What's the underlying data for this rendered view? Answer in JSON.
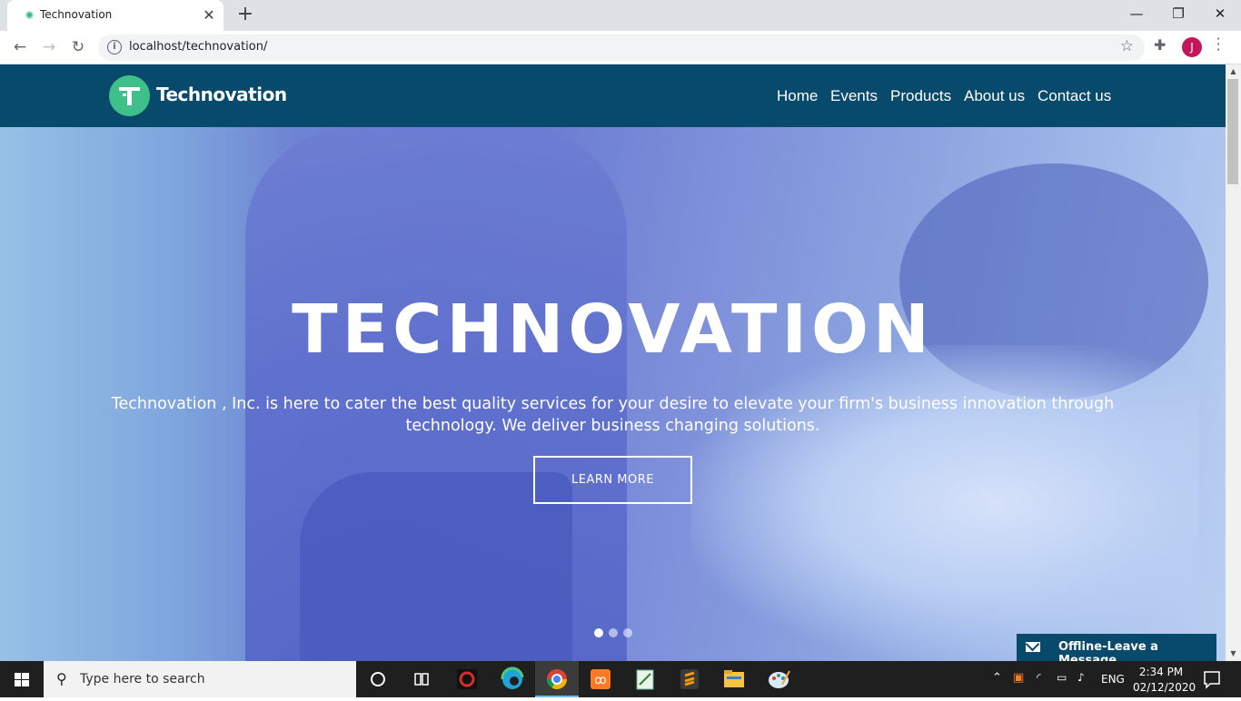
{
  "browser": {
    "tab_title": "Technovation",
    "url": "localhost/technovation/",
    "profile_initial": "J"
  },
  "site": {
    "brand": "Technovation",
    "nav": [
      "Home",
      "Events",
      "Products",
      "About us",
      "Contact us"
    ],
    "hero": {
      "title": "TECHNOVATION",
      "subtitle": "Technovation , Inc. is here to cater the best quality services for your desire to elevate your firm's business innovation through technology. We deliver business changing solutions.",
      "button": "LEARN MORE",
      "slide_count": 3,
      "active_slide": 1
    },
    "chat_label": "Offline-Leave a Message",
    "colors": {
      "navbar": "#074a6b",
      "logo": "#3fbf8a"
    }
  },
  "taskbar": {
    "search_placeholder": "Type here to search",
    "language": "ENG",
    "time": "2:34 PM",
    "date": "02/12/2020"
  }
}
